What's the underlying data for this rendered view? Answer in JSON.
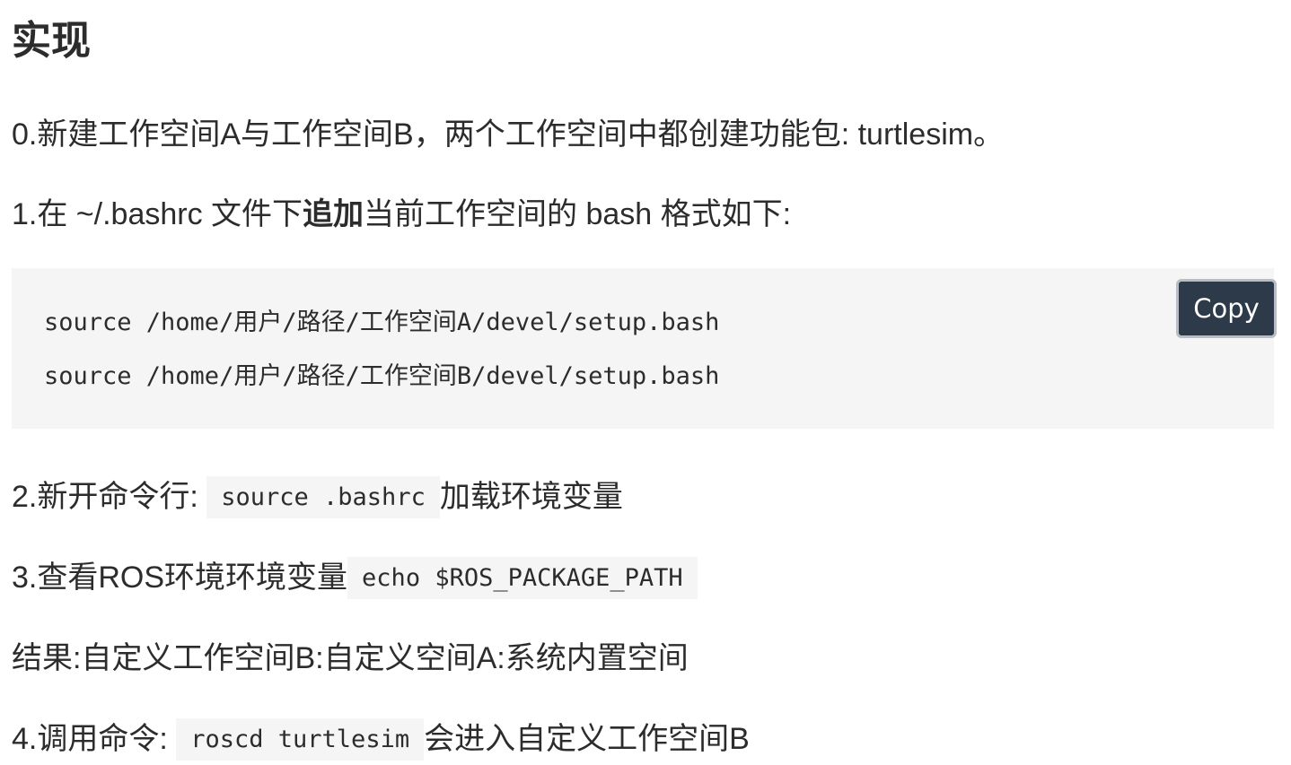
{
  "heading": "实现",
  "steps": {
    "step0": "0.新建工作空间A与工作空间B，两个工作空间中都创建功能包: turtlesim。",
    "step1": {
      "prefix": "1.在 ~/.bashrc 文件下",
      "bold": "追加",
      "suffix": "当前工作空间的 bash 格式如下:"
    },
    "step2": {
      "prefix": "2.新开命令行: ",
      "code": "source .bashrc",
      "suffix": "加载环境变量"
    },
    "step3": {
      "prefix": "3.查看ROS环境环境变量",
      "code": "echo $ROS_PACKAGE_PATH",
      "suffix": ""
    },
    "result": "结果:自定义工作空间B:自定义空间A:系统内置空间",
    "step4": {
      "prefix": "4.调用命令: ",
      "code": "roscd turtlesim",
      "suffix": "会进入自定义工作空间B"
    }
  },
  "code_block": {
    "lines": [
      "source /home/用户/路径/工作空间A/devel/setup.bash",
      "source /home/用户/路径/工作空间B/devel/setup.bash"
    ],
    "copy_label": "Copy"
  },
  "colors": {
    "text": "#2c2c2c",
    "code_background": "#f5f5f5",
    "copy_button_background": "#2d3a4a",
    "copy_button_border": "#b9bec4"
  }
}
